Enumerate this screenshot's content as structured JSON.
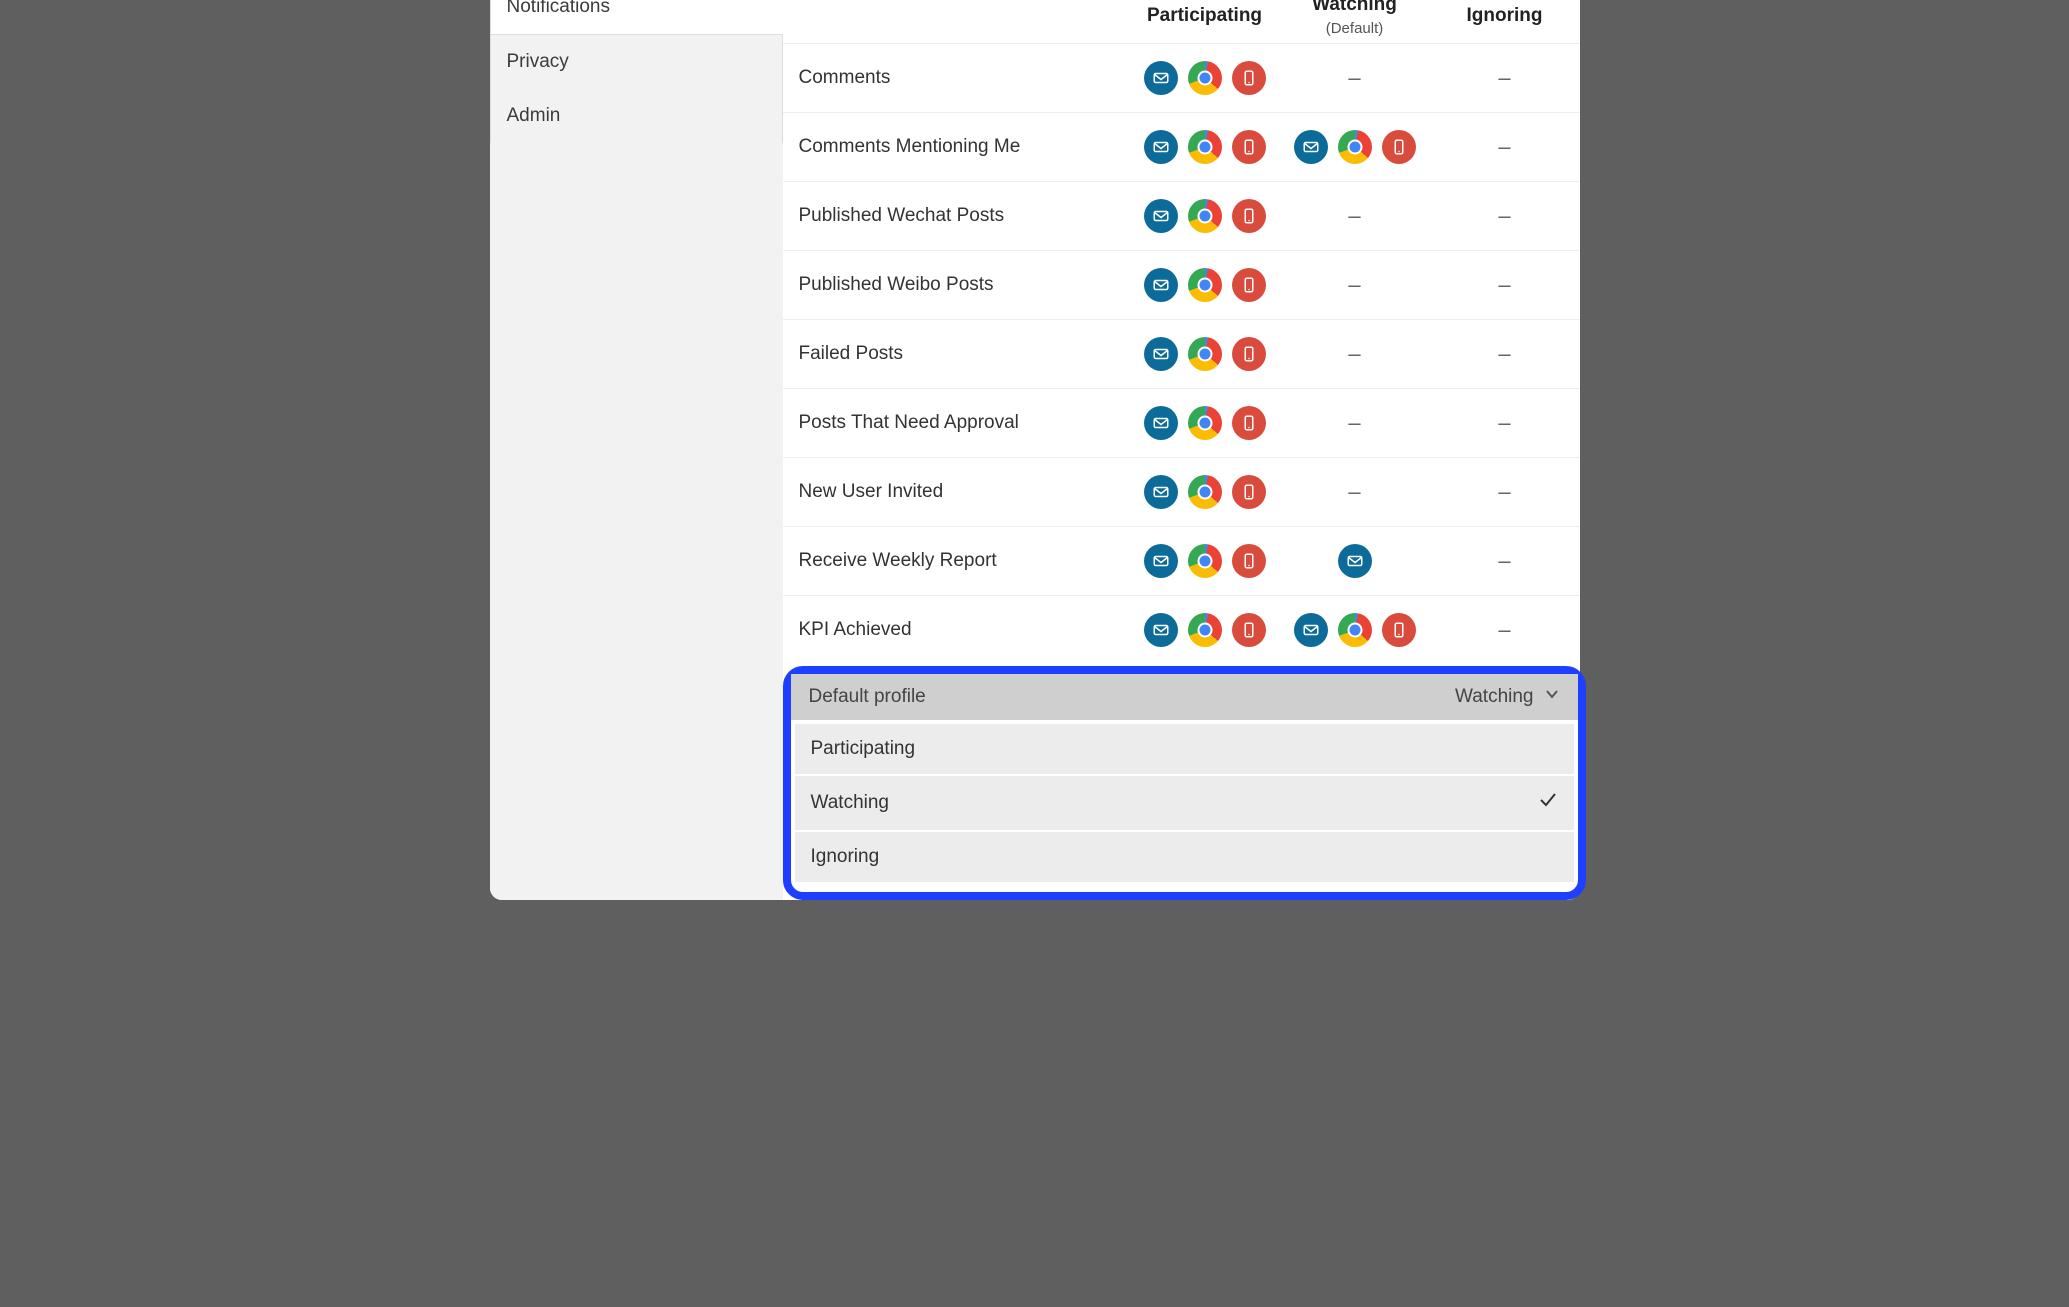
{
  "sidebar": {
    "items": [
      {
        "label": "Notifications",
        "active": true
      },
      {
        "label": "Privacy",
        "active": false
      },
      {
        "label": "Admin",
        "active": false
      }
    ]
  },
  "headers": {
    "participating": "Participating",
    "watching": "Watching",
    "watching_sub": "(Default)",
    "ignoring": "Ignoring"
  },
  "rows": [
    {
      "label": "Comments",
      "participating": [
        "email",
        "chrome",
        "mobile"
      ],
      "watching": "dash",
      "ignoring": "dash"
    },
    {
      "label": "Comments Mentioning Me",
      "participating": [
        "email",
        "chrome",
        "mobile"
      ],
      "watching": [
        "email",
        "chrome",
        "mobile"
      ],
      "ignoring": "dash"
    },
    {
      "label": "Published Wechat Posts",
      "participating": [
        "email",
        "chrome",
        "mobile"
      ],
      "watching": "dash",
      "ignoring": "dash"
    },
    {
      "label": "Published Weibo Posts",
      "participating": [
        "email",
        "chrome",
        "mobile"
      ],
      "watching": "dash",
      "ignoring": "dash"
    },
    {
      "label": "Failed Posts",
      "participating": [
        "email",
        "chrome",
        "mobile"
      ],
      "watching": "dash",
      "ignoring": "dash"
    },
    {
      "label": "Posts That Need Approval",
      "participating": [
        "email",
        "chrome",
        "mobile"
      ],
      "watching": "dash",
      "ignoring": "dash"
    },
    {
      "label": "New User Invited",
      "participating": [
        "email",
        "chrome",
        "mobile"
      ],
      "watching": "dash",
      "ignoring": "dash"
    },
    {
      "label": "Receive Weekly Report",
      "participating": [
        "email",
        "chrome",
        "mobile"
      ],
      "watching": [
        "email"
      ],
      "ignoring": "dash"
    },
    {
      "label": "KPI Achieved",
      "participating": [
        "email",
        "chrome",
        "mobile"
      ],
      "watching": [
        "email",
        "chrome",
        "mobile"
      ],
      "ignoring": "dash"
    }
  ],
  "default_profile": {
    "label": "Default profile",
    "value": "Watching",
    "options": [
      {
        "label": "Participating",
        "selected": false
      },
      {
        "label": "Watching",
        "selected": true
      },
      {
        "label": "Ignoring",
        "selected": false
      }
    ]
  },
  "colors": {
    "email": "#0d6b99",
    "mobile": "#d94c3d",
    "highlight": "#1e3fff"
  }
}
